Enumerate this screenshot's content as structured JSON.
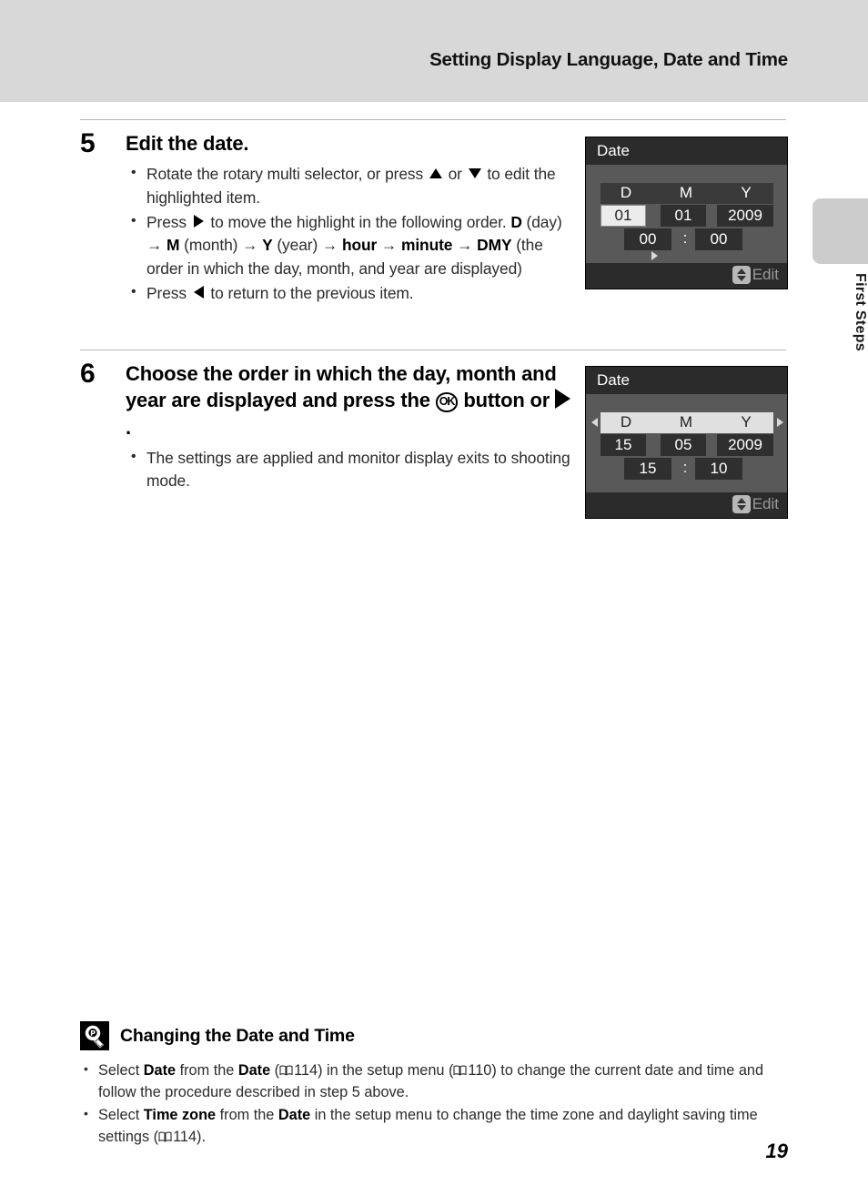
{
  "header": {
    "title": "Setting Display Language, Date and Time"
  },
  "side_tab": {
    "label": "First Steps"
  },
  "steps": [
    {
      "number": "5",
      "title": "Edit the date.",
      "bullets": [
        {
          "parts": [
            {
              "t": "text",
              "v": "Rotate the rotary multi selector, or press "
            },
            {
              "t": "icon",
              "v": "triangle-up-icon"
            },
            {
              "t": "text",
              "v": " or "
            },
            {
              "t": "icon",
              "v": "triangle-down-icon"
            },
            {
              "t": "text",
              "v": " to edit the highlighted item."
            }
          ]
        },
        {
          "parts": [
            {
              "t": "text",
              "v": "Press "
            },
            {
              "t": "icon",
              "v": "triangle-right-icon"
            },
            {
              "t": "text",
              "v": " to move the highlight in the following order. "
            },
            {
              "t": "bold",
              "v": "D"
            },
            {
              "t": "text",
              "v": " (day) → "
            },
            {
              "t": "bold",
              "v": "M"
            },
            {
              "t": "text",
              "v": " (month) → "
            },
            {
              "t": "bold",
              "v": "Y"
            },
            {
              "t": "text",
              "v": " (year) → "
            },
            {
              "t": "bold",
              "v": "hour"
            },
            {
              "t": "text",
              "v": " → "
            },
            {
              "t": "bold",
              "v": "minute"
            },
            {
              "t": "text",
              "v": " → "
            },
            {
              "t": "bold",
              "v": "DMY"
            },
            {
              "t": "text",
              "v": " (the order in which the day, month, and year are displayed)"
            }
          ]
        },
        {
          "parts": [
            {
              "t": "text",
              "v": "Press "
            },
            {
              "t": "icon",
              "v": "triangle-left-icon"
            },
            {
              "t": "text",
              "v": " to return to the previous item."
            }
          ]
        }
      ]
    },
    {
      "number": "6",
      "title_parts": [
        {
          "t": "text",
          "v": "Choose the order in which the day, month and year are displayed and press the "
        },
        {
          "t": "icon",
          "v": "ok-button-icon",
          "v2": "OK"
        },
        {
          "t": "text",
          "v": " button or "
        },
        {
          "t": "icon",
          "v": "triangle-right-icon"
        },
        {
          "t": "text",
          "v": "."
        }
      ],
      "bullets": [
        {
          "parts": [
            {
              "t": "text",
              "v": "The settings are applied and monitor display exits to shooting mode."
            }
          ]
        }
      ]
    }
  ],
  "screens": [
    {
      "id": "screen-1",
      "title": "Date",
      "columns": [
        "D",
        "M",
        "Y"
      ],
      "header_highlighted": false,
      "values": {
        "day": "01",
        "month": "01",
        "year": "2009"
      },
      "highlighted_field": "day",
      "time": {
        "hour": "00",
        "separator": ":",
        "minute": "00"
      },
      "cursor_arrow": "right-cursor-icon",
      "side_arrows": false,
      "footer": {
        "icon": "up-down-edit-icon",
        "label": "Edit"
      }
    },
    {
      "id": "screen-2",
      "title": "Date",
      "columns": [
        "D",
        "M",
        "Y"
      ],
      "header_highlighted": true,
      "values": {
        "day": "15",
        "month": "05",
        "year": "2009"
      },
      "highlighted_field": "none",
      "time": {
        "hour": "15",
        "separator": ":",
        "minute": "10"
      },
      "cursor_arrow": "none",
      "side_arrows": true,
      "footer": {
        "icon": "up-down-edit-icon",
        "label": "Edit"
      }
    }
  ],
  "note": {
    "icon": "lightbulb-tip-icon",
    "title": "Changing the Date and Time",
    "items": [
      {
        "parts": [
          {
            "t": "text",
            "v": "Select "
          },
          {
            "t": "bold",
            "v": "Date"
          },
          {
            "t": "text",
            "v": " from the "
          },
          {
            "t": "bold",
            "v": "Date"
          },
          {
            "t": "text",
            "v": " ("
          },
          {
            "t": "icon",
            "v": "book-icon"
          },
          {
            "t": "text",
            "v": "114) in the setup menu ("
          },
          {
            "t": "icon",
            "v": "book-icon"
          },
          {
            "t": "text",
            "v": "110) to change the current date and time and follow the procedure described in step 5 above."
          }
        ]
      },
      {
        "parts": [
          {
            "t": "text",
            "v": "Select "
          },
          {
            "t": "bold",
            "v": "Time zone"
          },
          {
            "t": "text",
            "v": " from the "
          },
          {
            "t": "bold",
            "v": "Date"
          },
          {
            "t": "text",
            "v": " in the setup menu to change the time zone and daylight saving time settings ("
          },
          {
            "t": "icon",
            "v": "book-icon"
          },
          {
            "t": "text",
            "v": "114)."
          }
        ]
      }
    ]
  },
  "page_number": "19",
  "colors": {
    "header_band": "#d8d8d8",
    "side_tab": "#cccccc",
    "screen_body": "#595959",
    "screen_bar": "#2b2b2b",
    "screen_field": "#2f2f2f",
    "screen_highlight": "#ececec",
    "rule": "#b5b5b5"
  }
}
